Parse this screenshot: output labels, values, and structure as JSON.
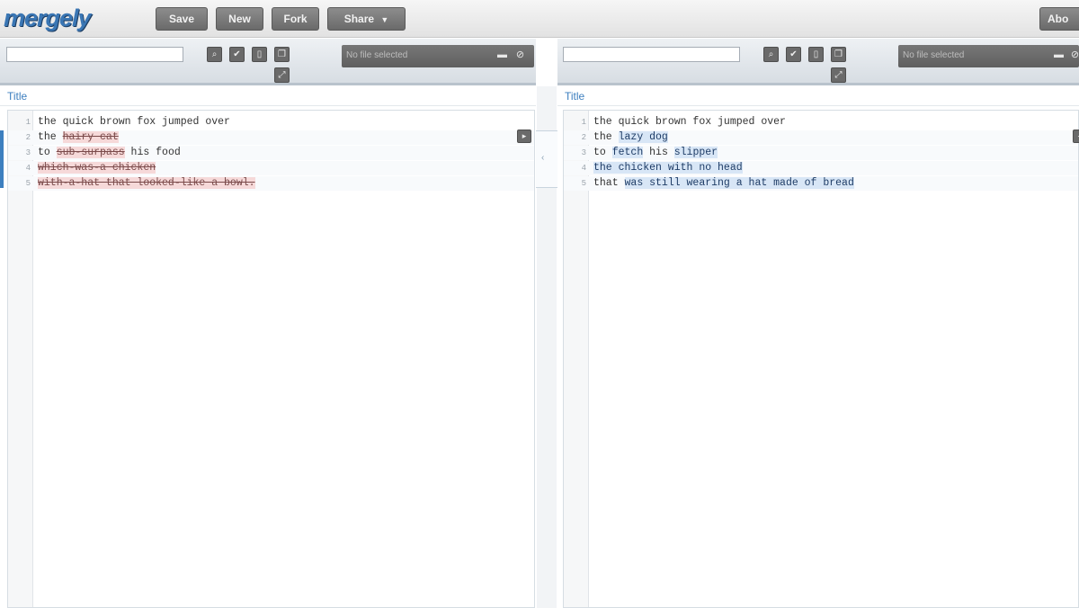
{
  "app": {
    "logo_text": "mergely"
  },
  "toolbar": {
    "save": "Save",
    "new": "New",
    "fork": "Fork",
    "share": "Share",
    "share_caret": "▼",
    "right_button": "Abo"
  },
  "left_pane": {
    "search_placeholder": "",
    "file_status": "No file selected",
    "title": "Title",
    "lines": [
      {
        "n": "1",
        "segments": [
          {
            "t": "the quick brown fox jumped over",
            "k": ""
          }
        ]
      },
      {
        "n": "2",
        "segments": [
          {
            "t": "the ",
            "k": ""
          },
          {
            "t": "hairy cat",
            "k": "del"
          }
        ]
      },
      {
        "n": "3",
        "segments": [
          {
            "t": "to ",
            "k": ""
          },
          {
            "t": "sub-surpass",
            "k": "del"
          },
          {
            "t": " his food",
            "k": ""
          }
        ]
      },
      {
        "n": "4",
        "segments": [
          {
            "t": "which-was-a chicken",
            "k": "del"
          }
        ]
      },
      {
        "n": "5",
        "segments": [
          {
            "t": "with-a-hat that looked-like a bowl.",
            "k": "del"
          }
        ]
      }
    ]
  },
  "right_pane": {
    "search_placeholder": "",
    "file_status": "No file selected",
    "title": "Title",
    "lines": [
      {
        "n": "1",
        "segments": [
          {
            "t": "the quick brown fox jumped over",
            "k": ""
          }
        ]
      },
      {
        "n": "2",
        "segments": [
          {
            "t": "the ",
            "k": ""
          },
          {
            "t": "lazy dog",
            "k": "ins"
          }
        ]
      },
      {
        "n": "3",
        "segments": [
          {
            "t": "to ",
            "k": ""
          },
          {
            "t": "fetch",
            "k": "ins"
          },
          {
            "t": " his ",
            "k": ""
          },
          {
            "t": "slipper",
            "k": "ins"
          }
        ]
      },
      {
        "n": "4",
        "segments": [
          {
            "t": "the chicken with no head",
            "k": "ins"
          }
        ]
      },
      {
        "n": "5",
        "segments": [
          {
            "t": "that ",
            "k": ""
          },
          {
            "t": "was still wearing a hat made of bread",
            "k": "ins"
          }
        ]
      }
    ]
  },
  "icons": {
    "search": "search-icon",
    "ok": "check-icon",
    "doc": "document-icon",
    "copy": "copy-icon",
    "open": "folder-icon",
    "clear": "clear-icon",
    "merge": "merge-arrow-icon"
  }
}
